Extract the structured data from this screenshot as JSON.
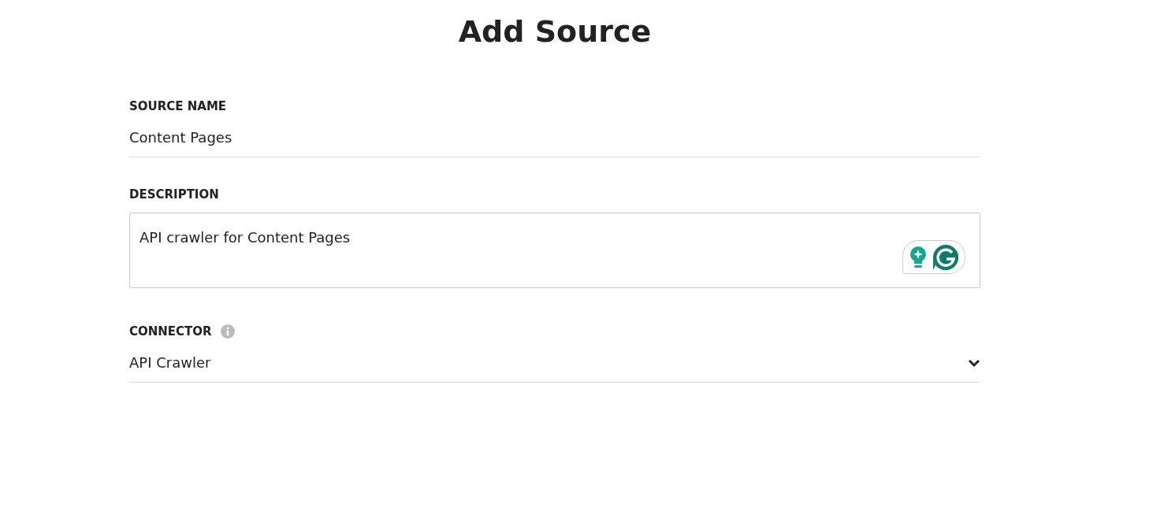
{
  "title": "Add Source",
  "fields": [
    {
      "kind": "text",
      "label": "SOURCE NAME",
      "value": "Content Pages"
    },
    {
      "kind": "textarea",
      "label": "DESCRIPTION",
      "value": "API crawler for Content Pages"
    },
    {
      "kind": "select",
      "label": "CONNECTOR",
      "value": "API Crawler"
    }
  ]
}
